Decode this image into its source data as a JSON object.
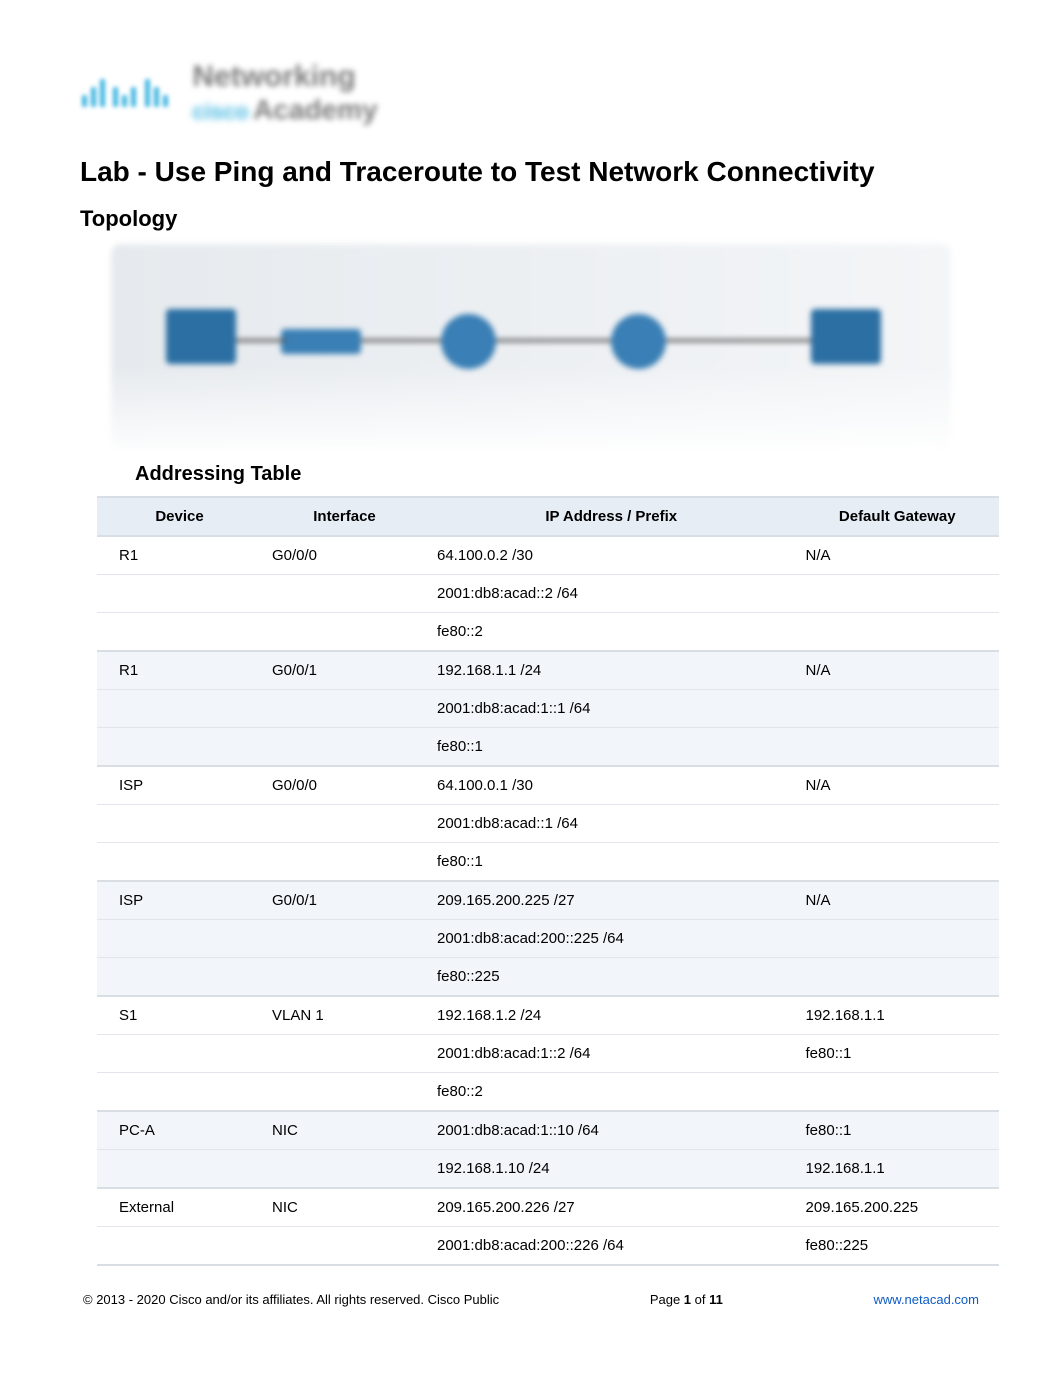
{
  "logo": {
    "brand": "cisco",
    "line1": "Networking",
    "line2": "Academy"
  },
  "title": "Lab - Use Ping and Traceroute to Test Network Connectivity",
  "section_topology": "Topology",
  "section_addressing": "Addressing Table",
  "table": {
    "headers": [
      "Device",
      "Interface",
      "IP Address / Prefix",
      "Default Gateway"
    ],
    "groups": [
      {
        "alt": false,
        "rows": [
          [
            "R1",
            "G0/0/0",
            "64.100.0.2 /30",
            "N/A"
          ],
          [
            "",
            "",
            "2001:db8:acad::2 /64",
            ""
          ],
          [
            "",
            "",
            "fe80::2",
            ""
          ]
        ]
      },
      {
        "alt": true,
        "rows": [
          [
            "R1",
            "G0/0/1",
            "192.168.1.1 /24",
            "N/A"
          ],
          [
            "",
            "",
            "2001:db8:acad:1::1 /64",
            ""
          ],
          [
            "",
            "",
            "fe80::1",
            ""
          ]
        ]
      },
      {
        "alt": false,
        "rows": [
          [
            "ISP",
            "G0/0/0",
            "64.100.0.1 /30",
            "N/A"
          ],
          [
            "",
            "",
            "2001:db8:acad::1 /64",
            ""
          ],
          [
            "",
            "",
            "fe80::1",
            ""
          ]
        ]
      },
      {
        "alt": true,
        "rows": [
          [
            "ISP",
            "G0/0/1",
            "209.165.200.225 /27",
            "N/A"
          ],
          [
            "",
            "",
            "2001:db8:acad:200::225 /64",
            ""
          ],
          [
            "",
            "",
            "fe80::225",
            ""
          ]
        ]
      },
      {
        "alt": false,
        "rows": [
          [
            "S1",
            "VLAN 1",
            "192.168.1.2 /24",
            "192.168.1.1"
          ],
          [
            "",
            "",
            "2001:db8:acad:1::2 /64",
            "fe80::1"
          ],
          [
            "",
            "",
            "fe80::2",
            ""
          ]
        ]
      },
      {
        "alt": true,
        "rows": [
          [
            "PC-A",
            "NIC",
            "2001:db8:acad:1::10 /64",
            "fe80::1"
          ],
          [
            "",
            "",
            "192.168.1.10 /24",
            "192.168.1.1"
          ]
        ]
      },
      {
        "alt": false,
        "rows": [
          [
            "External",
            "NIC",
            "209.165.200.226 /27",
            "209.165.200.225"
          ],
          [
            "",
            "",
            "2001:db8:acad:200::226 /64",
            "fe80::225"
          ]
        ]
      }
    ]
  },
  "footer": {
    "copyright": "2013 - 2020 Cisco and/or its affiliates. All rights reserved. Cisco Public",
    "page_label_pre": "Page ",
    "page_num": "1",
    "page_of": " of ",
    "page_total": "11",
    "url": "www.netacad.com"
  }
}
